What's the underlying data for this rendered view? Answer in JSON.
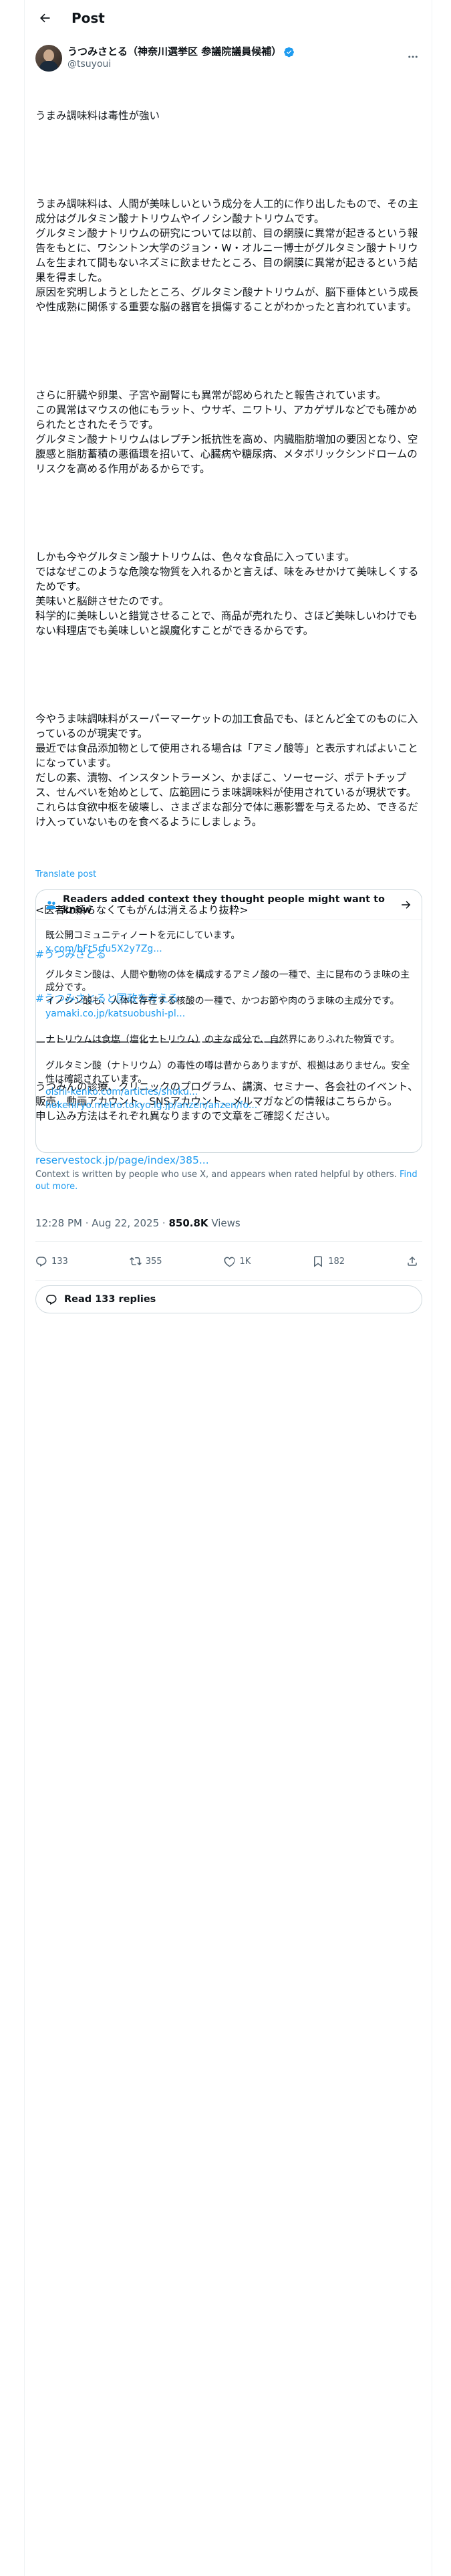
{
  "header": {
    "title": "Post"
  },
  "author": {
    "display_name": "うつみさとる（神奈川選挙区 参議院議員候補）",
    "handle": "@tsuyoui"
  },
  "post": {
    "paragraphs": [
      "うまみ調味料は毒性が強い",
      "",
      "うまみ調味料は、人間が美味しいという成分を人工的に作り出したもので、その主成分はグルタミン酸ナトリウムやイノシン酸ナトリウムです。\nグルタミン酸ナトリウムの研究については以前、目の網膜に異常が起きるという報告をもとに、ワシントン大学のジョン・W・オルニー博士がグルタミン酸ナトリウムを生まれて間もないネズミに飲ませたところ、目の網膜に異常が起きるという結果を得ました。\n原因を究明しようとしたところ、グルタミン酸ナトリウムが、脳下垂体という成長や性成熟に関係する重要な脳の器官を損傷することがわかったと言われています。",
      "",
      "さらに肝臓や卵巣、子宮や副腎にも異常が認められたと報告されています。\nこの異常はマウスの他にもラット、ウサギ、ニワトリ、アカゲザルなどでも確かめられたとされたそうです。\nグルタミン酸ナトリウムはレプチン抵抗性を高め、内臓脂肪増加の要因となり、空腹感と脂肪蓄積の悪循環を招いて、心臓病や糖尿病、メタボリックシンドロームのリスクを高める作用があるからです。",
      "",
      "しかも今やグルタミン酸ナトリウムは、色々な食品に入っています。\nではなぜこのような危険な物質を入れるかと言えば、味をみせかけて美味しくするためです。\n美味いと脳餅させたのです。\n科学的に美味しいと錯覚させることで、商品が売れたり、さほど美味しいわけでもない料理店でも美味しいと誤魔化すことができるからです。",
      "",
      "今やうま味調味料がスーパーマーケットの加工食品でも、ほとんど全てのものに入っているのが現実です。\n最近では食品添加物として使用される場合は「アミノ酸等」と表示すればよいことになっています。\nだしの素、漬物、インスタントラーメン、かまぼこ、ソーセージ、ポテトチップス、せんべいを始めとして、広範囲にうま味調味料が使用されているが現状です。\nこれらは食欲中枢を破壊し、さまざまな部分で体に悪影響を与えるため、できるだけ入っていないものを食べるようにしましょう。",
      "",
      "<医者に頼らなくてもがんは消えるより抜粋>",
      ""
    ],
    "hashtags": [
      "#うつみさとる",
      "#うつみさとると国政を考える"
    ],
    "separator": "ーーーーーーーーーーーーーーーーーーーーーーーー",
    "promo": "うつみんの診療、クリニックのプログラム、講演、セミナー、各会社のイベント、販売、動画アカウント、SNSアカウント、メルマガなどの情報はこちらから。\n申し込み方法はそれぞれ異なりますので文章をご確認ください。",
    "link": "reservestock.jp/page/index/385...",
    "translate": "Translate post"
  },
  "community_note": {
    "title": "Readers added context they thought people might want to know",
    "intro": "既公開コミュニティノートを元にしています。",
    "intro_link": "x.com/bFt5rfu5X2y7Zg...",
    "points": [
      {
        "text": "グルタミン酸は、人間や動物の体を構成するアミノ酸の一種で、主に昆布のうま味の主成分です。\nイノシン酸も、人体に存在する核酸の一種で、かつお節や肉のうま味の主成分です。",
        "link": "yamaki.co.jp/katsuobushi-pl..."
      },
      {
        "text": "ナトリウムは食塩（塩化ナトリウム）の主な成分で、自然界にありふれた物質です。",
        "link": ""
      },
      {
        "text": "グルタミン酸（ナトリウム）の毒性の噂は昔からありますが、根拠はありません。安全性は確認されています。",
        "link": "oishi-kenko.com/articles/shoku..."
      },
      {
        "text": "",
        "link": "hokeniryo.metro.tokyo.lg.jp/anzen/anzen/fo..."
      }
    ],
    "footer_text": "Context is written by people who use X, and appears when rated helpful by others.",
    "footer_link": "Find out more."
  },
  "meta": {
    "time": "12:28 PM · Aug 22, 2025",
    "separator": " · ",
    "views_count": "850.8K",
    "views_label": " Views"
  },
  "actions": {
    "replies": "133",
    "reposts": "355",
    "likes": "1K",
    "bookmarks": "182"
  },
  "read_replies": "Read 133 replies",
  "colors": {
    "accent": "#1d9bf0",
    "text": "#0f1419",
    "muted": "#536471",
    "border": "#cfd9de"
  }
}
